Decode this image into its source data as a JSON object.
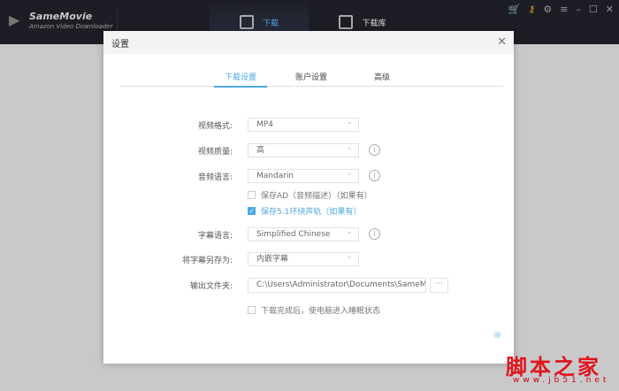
{
  "app": {
    "name": "SameMovie",
    "subtitle": "Amazon Video Downloader"
  },
  "nav": {
    "download": "下载",
    "library": "下载库"
  },
  "dialog": {
    "title": "设置",
    "tabs": [
      "下载设置",
      "账户设置",
      "高级"
    ],
    "fields": {
      "video_format": {
        "label": "视频格式:",
        "value": "MP4"
      },
      "video_quality": {
        "label": "视频质量:",
        "value": "高"
      },
      "audio_language": {
        "label": "音频语言:",
        "value": "Mandarin"
      },
      "save_ad": {
        "label": "保存AD（音频描述）（如果有）",
        "checked": false
      },
      "save_51": {
        "label": "保存5.1环绕声轨（如果有）",
        "checked": true
      },
      "subtitle_language": {
        "label": "字幕语言:",
        "value": "Simplified Chinese"
      },
      "save_subtitle_as": {
        "label": "将字幕另存为:",
        "value": "内嵌字幕"
      },
      "output_folder": {
        "label": "输出文件夹:",
        "value": "C:\\Users\\Administrator\\Documents\\SameMovie",
        "browse": "···"
      },
      "sleep_after": {
        "label": "下载完成后，使电脑进入睡眠状态",
        "checked": false
      }
    }
  },
  "watermark": {
    "text": "脚本之家",
    "url": "www.jb51.net"
  },
  "colors": {
    "accent": "#4fa9e2",
    "header": "#1d1e25"
  }
}
